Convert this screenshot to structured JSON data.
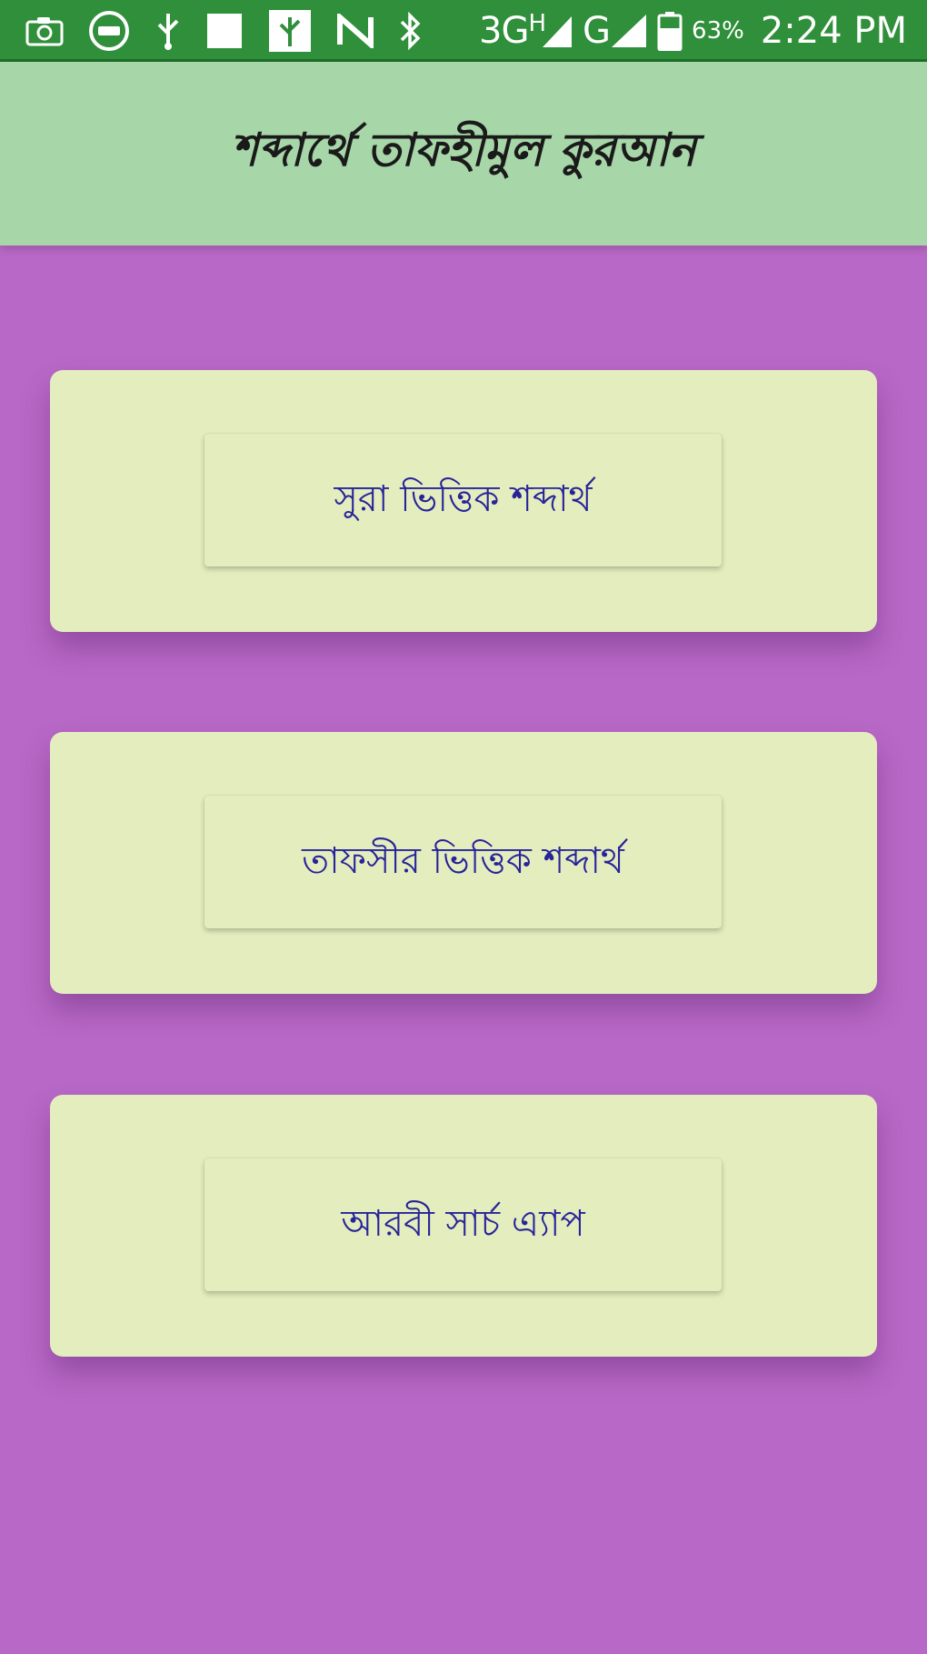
{
  "status_bar": {
    "icons": [
      "camera-icon",
      "data-saver-icon",
      "usb-icon",
      "square-notification-icon",
      "sim-toolkit-icon",
      "nfc-icon",
      "bluetooth-icon",
      "signal-3g-icon",
      "signal-g-icon",
      "battery-icon"
    ],
    "network_3g": "3G",
    "network_3g_sup": "H",
    "network_g": "G",
    "battery": "63%",
    "time": "2:24 PM"
  },
  "app_bar": {
    "title": "শব্দার্থে তাফহীমুল কুরআন"
  },
  "menu": {
    "buttons": [
      {
        "label": "সুরা ভিত্তিক শব্দার্থ"
      },
      {
        "label": "তাফসীর ভিত্তিক শব্দার্থ"
      },
      {
        "label": "আরবী সার্চ এ্যাপ"
      }
    ]
  },
  "colors": {
    "status_bar": "#2f8f3a",
    "app_bar": "#a7d6a8",
    "background": "#b868c6",
    "card": "#e4edbd",
    "button_text": "#27239a"
  }
}
